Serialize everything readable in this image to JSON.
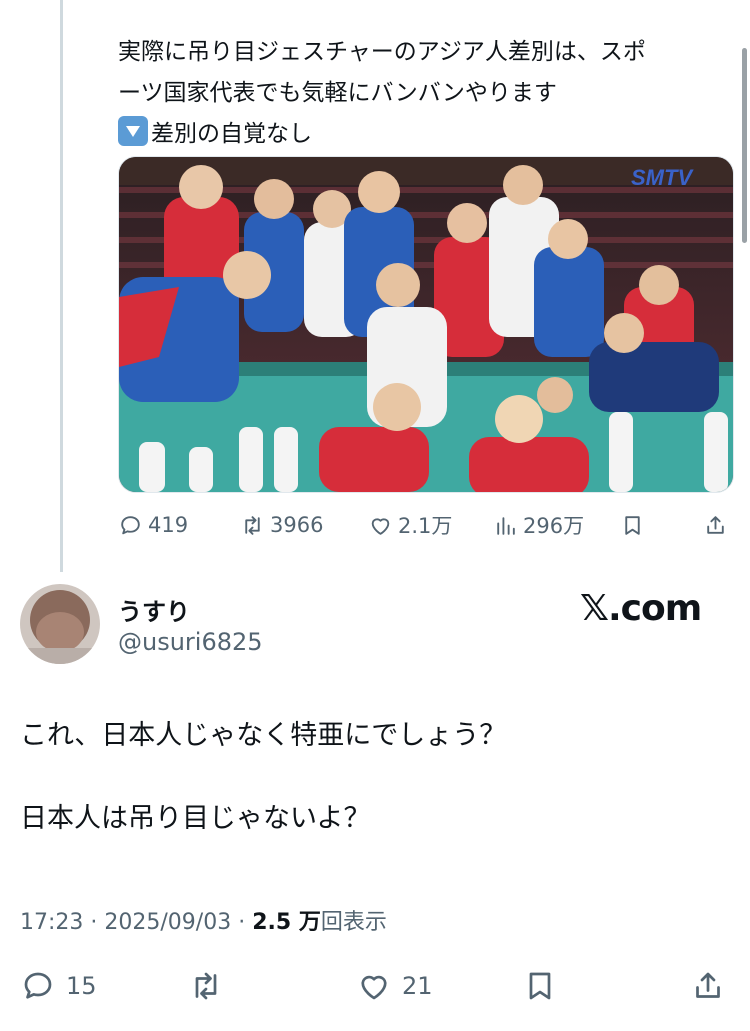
{
  "quoted_post": {
    "text_lines": [
      "実際に吊り目ジェスチャーのアジア人差別は、スポ",
      "ーツ国家代表でも気軽にバンバンやります",
      "差別の自覚なし"
    ],
    "bullet_icon": "down-triangle-emoji-icon",
    "media_watermark": "SMTV",
    "media_description_icon": "photo-image",
    "stats": {
      "replies": "419",
      "reposts": "3966",
      "likes": "2.1万",
      "views": "296万"
    }
  },
  "post": {
    "display_name": "うすり",
    "handle": "@usuri6825",
    "brand": "𝕏.com",
    "text_paragraphs": [
      "これ、日本人じゃなく特亜にでしょう？",
      "日本人は吊り目じゃないよ？"
    ],
    "meta": {
      "time": "17:23",
      "separator": " · ",
      "date": "2025/09/03",
      "separator2": " · ",
      "views_number": "2.5 万",
      "views_label": "回表示"
    },
    "stats": {
      "replies": "15",
      "likes": "21"
    }
  },
  "colors": {
    "text": "#0f1419",
    "secondary": "#536471",
    "thread_line": "#cfd9de",
    "jersey_red": "#d62d3a",
    "jersey_blue": "#2b5fb8",
    "court": "#3fa9a1"
  }
}
